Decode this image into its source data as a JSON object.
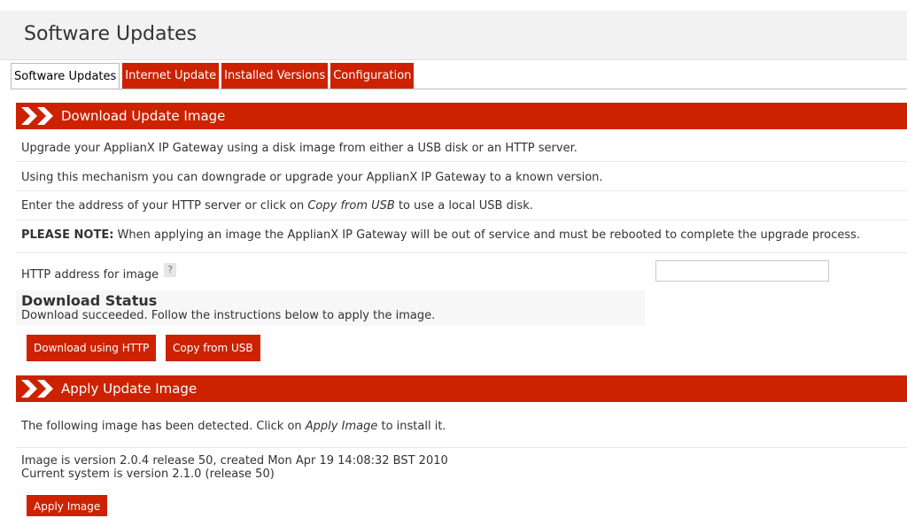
{
  "page": {
    "title": "Software Updates"
  },
  "tabs": [
    {
      "label": "Software Updates",
      "active": true
    },
    {
      "label": "Internet Update",
      "active": false
    },
    {
      "label": "Installed Versions",
      "active": false
    },
    {
      "label": "Configuration",
      "active": false
    }
  ],
  "download_section": {
    "header": "Download Update Image",
    "para1": "Upgrade your ApplianX IP Gateway using a disk image from either a USB disk or an HTTP server.",
    "para2": "Using this mechanism you can downgrade or upgrade your ApplianX IP Gateway to a known version.",
    "para3_prefix": "Enter the address of your HTTP server or click on ",
    "para3_link": "Copy from USB",
    "para3_suffix": " to use a local USB disk.",
    "note_label": "PLEASE NOTE:",
    "note_text": " When applying an image the ApplianX IP Gateway will be out of service and must be rebooted to complete the upgrade process.",
    "http_label": "HTTP address for image",
    "help_glyph": "?",
    "http_value": "",
    "status_heading": "Download Status",
    "status_text": "Download succeeded. Follow the instructions below to apply the image.",
    "download_button": "Download using HTTP",
    "usb_button": "Copy from USB"
  },
  "apply_section": {
    "header": "Apply Update Image",
    "detected_prefix": "The following image has been detected. Click on ",
    "detected_link": "Apply Image",
    "detected_suffix": " to install it.",
    "image_version": "Image is version 2.0.4 release 50, created Mon Apr 19 14:08:32 BST 2010",
    "current_version": "Current system is version 2.1.0 (release 50)",
    "apply_button": "Apply Image"
  },
  "colors": {
    "accent": "#cc2200",
    "title_bar": "#f2f2f2",
    "text": "#333333"
  },
  "icons": {
    "section_header": "double-chevron-right-icon"
  }
}
